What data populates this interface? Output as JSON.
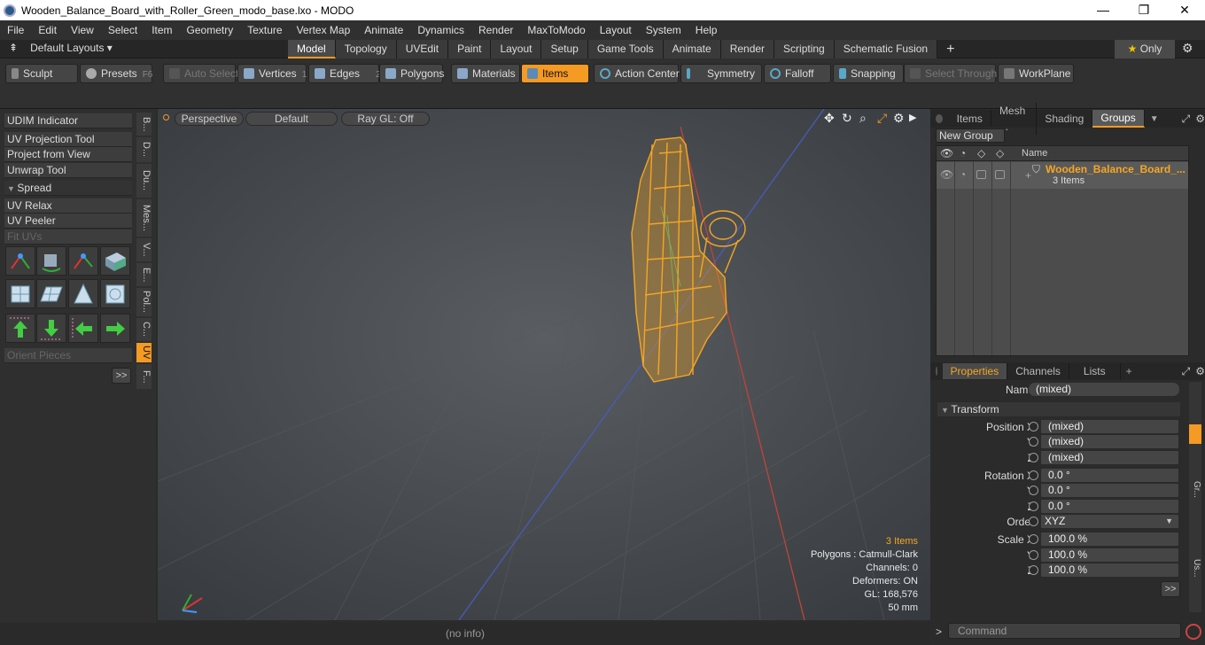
{
  "window": {
    "title": "Wooden_Balance_Board_with_Roller_Green_modo_base.lxo - MODO",
    "minimize": "—",
    "maximize": "❐",
    "close": "✕"
  },
  "menu": [
    "File",
    "Edit",
    "View",
    "Select",
    "Item",
    "Geometry",
    "Texture",
    "Vertex Map",
    "Animate",
    "Dynamics",
    "Render",
    "MaxToModo",
    "Layout",
    "System",
    "Help"
  ],
  "layouts": {
    "label": "Default Layouts ▾",
    "tabs": [
      "Model",
      "Topology",
      "UVEdit",
      "Paint",
      "Layout",
      "Setup",
      "Game Tools",
      "Animate",
      "Render",
      "Scripting",
      "Schematic Fusion"
    ],
    "active": "Model",
    "plus": "+",
    "only": "Only",
    "star": "★"
  },
  "toolbar": {
    "sculpt": "Sculpt",
    "presets": "Presets",
    "presets_key": "F6",
    "auto_select": "Auto Select",
    "vertices": "Vertices",
    "vertices_key": "1",
    "edges": "Edges",
    "edges_key": "2",
    "polygons": "Polygons",
    "materials": "Materials",
    "items": "Items",
    "action_center": "Action Center",
    "symmetry": "Symmetry",
    "falloff": "Falloff",
    "snapping": "Snapping",
    "select_through": "Select Through",
    "workplane": "WorkPlane"
  },
  "left": {
    "udim": "UDIM Indicator",
    "uv_projection": "UV Projection Tool",
    "project_view": "Project from View",
    "unwrap": "Unwrap Tool",
    "spread": "Spread",
    "uv_relax": "UV Relax",
    "uv_peeler": "UV Peeler",
    "fit_uvs": "Fit UVs",
    "orient": "Orient Pieces",
    "more": ">>",
    "vtabs": [
      "B...",
      "D...",
      "Du...",
      "Mes...",
      "V...",
      "E...",
      "Pol...",
      "C...",
      "UV",
      "F..."
    ]
  },
  "viewport": {
    "perspective": "Perspective",
    "shading": "Default",
    "raygl": "Ray GL: Off",
    "items": "3 Items",
    "polygons": "Polygons : Catmull-Clark",
    "channels": "Channels: 0",
    "deformers": "Deformers: ON",
    "gl": "GL: 168,576",
    "scale": "50 mm"
  },
  "status": "(no info)",
  "right": {
    "top_tabs": [
      "Items",
      "Mesh ...",
      "Shading",
      "Groups"
    ],
    "new_group": "New Group",
    "name_col": "Name",
    "group_name": "Wooden_Balance_Board_...",
    "group_count": "3 Items",
    "prop_tabs": [
      "Properties",
      "Channels",
      "Lists"
    ],
    "name_label": "Name",
    "name_value": "(mixed)",
    "transform": "Transform",
    "pos_label": "Position X",
    "pos": [
      "(mixed)",
      "(mixed)",
      "(mixed)"
    ],
    "rot_label": "Rotation X",
    "rot": [
      "0.0 °",
      "0.0 °",
      "0.0 °"
    ],
    "order_label": "Order",
    "order": "XYZ",
    "scale_label": "Scale X",
    "scale": [
      "100.0 %",
      "100.0 %",
      "100.0 %"
    ],
    "y": "Y",
    "z": "Z",
    "more": ">>",
    "command": "Command",
    "side_tabs": [
      "Gr...",
      "Us..."
    ]
  },
  "colors": {
    "accent": "#f59a23",
    "wire": "#f5a623"
  }
}
